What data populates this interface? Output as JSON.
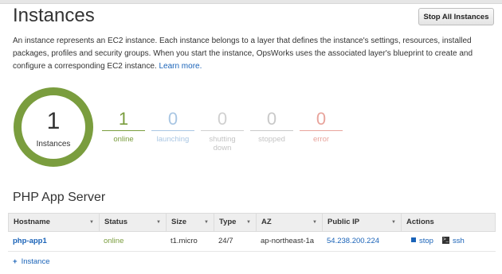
{
  "header": {
    "title": "Instances",
    "stop_all_label": "Stop All Instances"
  },
  "description": {
    "text": "An instance represents an EC2 instance. Each instance belongs to a layer that defines the instance's settings, resources, installed packages, profiles and security groups. When you start the instance, OpsWorks uses the associated layer's blueprint to create and configure a corresponding EC2 instance.",
    "link": "Learn more."
  },
  "summary": {
    "total": "1",
    "total_label": "Instances",
    "stats": [
      {
        "count": "1",
        "label": "online",
        "color": "#7a9d3e"
      },
      {
        "count": "0",
        "label": "launching",
        "color": "#a9c6e3"
      },
      {
        "count": "0",
        "label": "shutting down",
        "color": "#d0d0d0"
      },
      {
        "count": "0",
        "label": "stopped",
        "color": "#c9c9c9"
      },
      {
        "count": "0",
        "label": "error",
        "color": "#e8a49c"
      }
    ]
  },
  "layer": {
    "title": "PHP App Server",
    "columns": [
      "Hostname",
      "Status",
      "Size",
      "Type",
      "AZ",
      "Public IP",
      "Actions"
    ],
    "rows": [
      {
        "hostname": "php-app1",
        "status": "online",
        "size": "t1.micro",
        "type": "24/7",
        "az": "ap-northeast-1a",
        "public_ip": "54.238.200.224",
        "action_stop": "stop",
        "action_ssh": "ssh"
      }
    ],
    "add_instance_label": "Instance"
  }
}
